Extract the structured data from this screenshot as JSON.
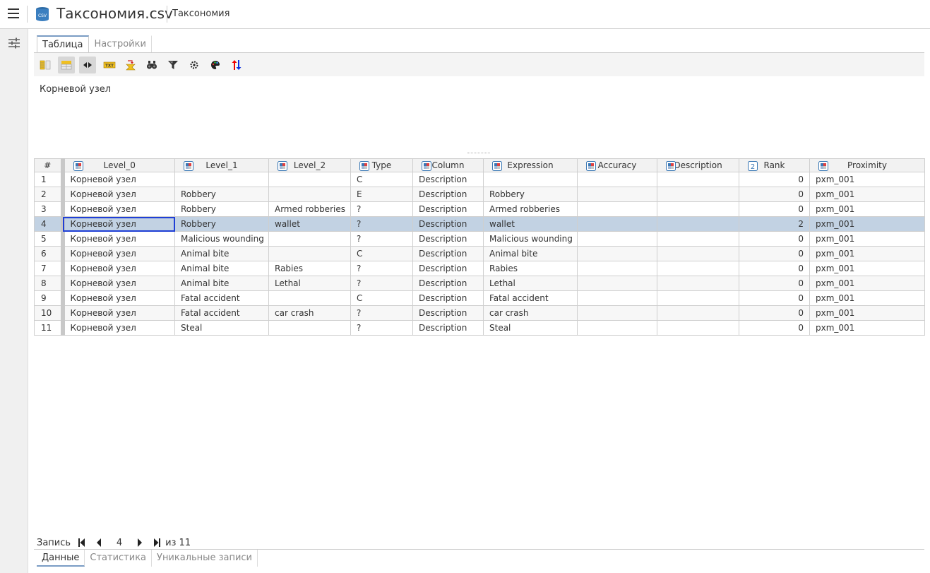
{
  "header": {
    "file_icon": "csv-database-icon",
    "file_icon_label": "CSV",
    "title": "Таксономия.csv",
    "subtitle": "Таксономия"
  },
  "top_tabs": [
    {
      "label": "Таблица",
      "active": true
    },
    {
      "label": "Настройки",
      "active": false
    }
  ],
  "toolbar": [
    {
      "name": "columns-panel-icon",
      "pressed": false
    },
    {
      "name": "table-header-icon",
      "pressed": true
    },
    {
      "name": "fit-width-icon",
      "pressed": true
    },
    {
      "name": "txt-export-icon",
      "pressed": false
    },
    {
      "name": "excel-export-icon",
      "pressed": false
    },
    {
      "name": "find-binoculars-icon",
      "pressed": false
    },
    {
      "name": "filter-icon",
      "pressed": false
    },
    {
      "name": "settings-gear-icon",
      "pressed": false
    },
    {
      "name": "palette-icon",
      "pressed": false
    },
    {
      "name": "sort-icon",
      "pressed": false
    }
  ],
  "node_label": "Корневой узел",
  "table": {
    "columns": [
      {
        "label": "#",
        "type": "none"
      },
      {
        "label": "Level_0",
        "type": "category"
      },
      {
        "label": "Level_1",
        "type": "category"
      },
      {
        "label": "Level_2",
        "type": "category"
      },
      {
        "label": "Type",
        "type": "category"
      },
      {
        "label": "Column",
        "type": "category"
      },
      {
        "label": "Expression",
        "type": "category"
      },
      {
        "label": "Accuracy",
        "type": "category"
      },
      {
        "label": "Description",
        "type": "category"
      },
      {
        "label": "Rank",
        "type": "number"
      },
      {
        "label": "Proximity",
        "type": "category"
      }
    ],
    "rows": [
      [
        "1",
        "Корневой узел",
        "",
        "",
        "C",
        "Description",
        "",
        "",
        "",
        "0",
        "pxm_001"
      ],
      [
        "2",
        "Корневой узел",
        "Robbery",
        "",
        "E",
        "Description",
        "Robbery",
        "",
        "",
        "0",
        "pxm_001"
      ],
      [
        "3",
        "Корневой узел",
        "Robbery",
        "Armed robberies",
        "?",
        "Description",
        "Armed robberies",
        "",
        "",
        "0",
        "pxm_001"
      ],
      [
        "4",
        "Корневой узел",
        "Robbery",
        "wallet",
        "?",
        "Description",
        "wallet",
        "",
        "",
        "2",
        "pxm_001"
      ],
      [
        "5",
        "Корневой узел",
        "Malicious wounding",
        "",
        "?",
        "Description",
        "Malicious wounding",
        "",
        "",
        "0",
        "pxm_001"
      ],
      [
        "6",
        "Корневой узел",
        "Animal bite",
        "",
        "C",
        "Description",
        "Animal bite",
        "",
        "",
        "0",
        "pxm_001"
      ],
      [
        "7",
        "Корневой узел",
        "Animal bite",
        "Rabies",
        "?",
        "Description",
        "Rabies",
        "",
        "",
        "0",
        "pxm_001"
      ],
      [
        "8",
        "Корневой узел",
        "Animal bite",
        "Lethal",
        "?",
        "Description",
        "Lethal",
        "",
        "",
        "0",
        "pxm_001"
      ],
      [
        "9",
        "Корневой узел",
        "Fatal accident",
        "",
        "C",
        "Description",
        "Fatal accident",
        "",
        "",
        "0",
        "pxm_001"
      ],
      [
        "10",
        "Корневой узел",
        "Fatal accident",
        "car crash",
        "?",
        "Description",
        "car crash",
        "",
        "",
        "0",
        "pxm_001"
      ],
      [
        "11",
        "Корневой узел",
        "Steal",
        "",
        "?",
        "Description",
        "Steal",
        "",
        "",
        "0",
        "pxm_001"
      ]
    ],
    "selected_row": 4
  },
  "navigator": {
    "label": "Запись",
    "current": "4",
    "total_label": "из 11"
  },
  "bottom_tabs": [
    {
      "label": "Данные",
      "active": true
    },
    {
      "label": "Статистика",
      "active": false
    },
    {
      "label": "Уникальные записи",
      "active": false
    }
  ],
  "colors": {
    "selected_row": "#c2d2e3",
    "focus_cell_border": "#1f3fd6",
    "tab_accent": "#7a9cc4"
  }
}
